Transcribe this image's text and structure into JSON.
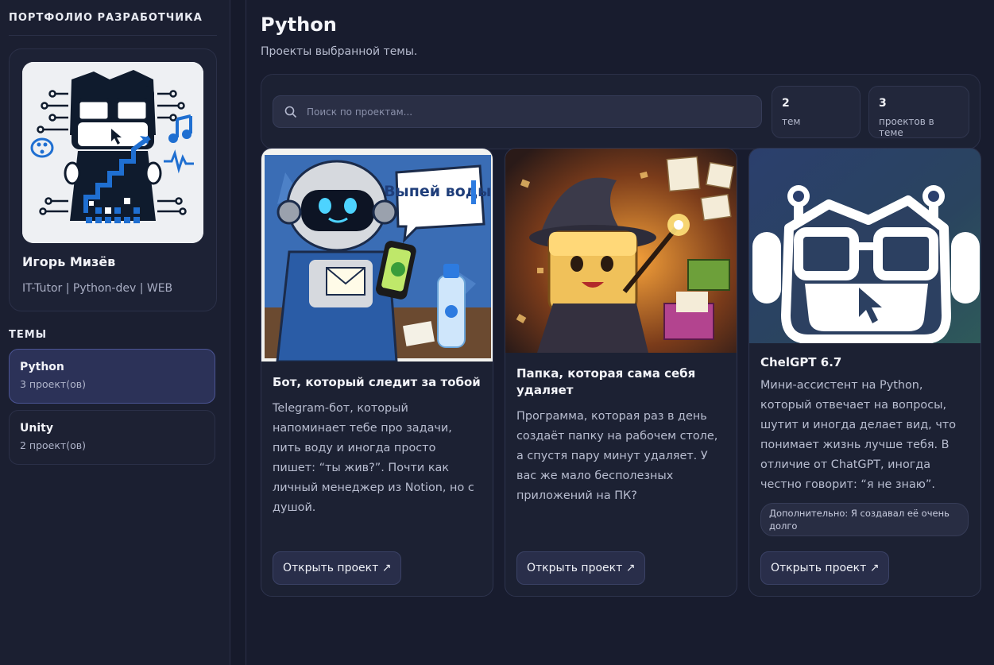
{
  "sidebar": {
    "brand": "ПОРТФОЛИО РАЗРАБОТЧИКА",
    "profile": {
      "name": "Игорь Мизёв",
      "role": "IT-Tutor | Python-dev | WEB"
    },
    "themes_title": "ТЕМЫ",
    "themes": [
      {
        "name": "Python",
        "count": "3 проект(ов)",
        "active": true
      },
      {
        "name": "Unity",
        "count": "2 проект(ов)",
        "active": false
      }
    ]
  },
  "main": {
    "title": "Python",
    "subtitle": "Проекты выбранной темы.",
    "search": {
      "placeholder": "Поиск по проектам..."
    },
    "stats": [
      {
        "value": "2",
        "label": "тем"
      },
      {
        "value": "3",
        "label": "проектов в теме"
      }
    ],
    "cards": [
      {
        "title": "Бот, который следит за тобой",
        "description": "Telegram-бот, который напоминает тебе про задачи, пить воду и иногда просто пишет: “ты жив?”. Почти как личный менеджер из Notion, но с душой.",
        "image": "robot-water-reminder-image",
        "image_text": "Выпей воды!",
        "button": "Открыть проект ↗"
      },
      {
        "title": "Папка, которая сама себя удаляет",
        "description": "Программа, которая раз в день создаёт папку на рабочем столе, а спустя пару минут удаляет. У вас же мало бесполезных приложений на ПК?",
        "image": "wizard-folder-image",
        "button": "Открыть проект ↗"
      },
      {
        "title": "ChelGPT 6.7",
        "description": "Мини-ассистент на Python, который отвечает на вопросы, шутит и иногда делает вид, что понимает жизнь лучше тебя. В отличие от ChatGPT, иногда честно говорит: “я не знаю”.",
        "extra": "Дополнительно: Я создавал её очень долго",
        "image": "robot-head-logo-image",
        "button": "Открыть проект ↗"
      }
    ]
  },
  "colors": {
    "background": "#161a2b",
    "panel": "#1c2133",
    "active_theme": "#2c3258",
    "accent_blue": "#1f6fd1"
  }
}
